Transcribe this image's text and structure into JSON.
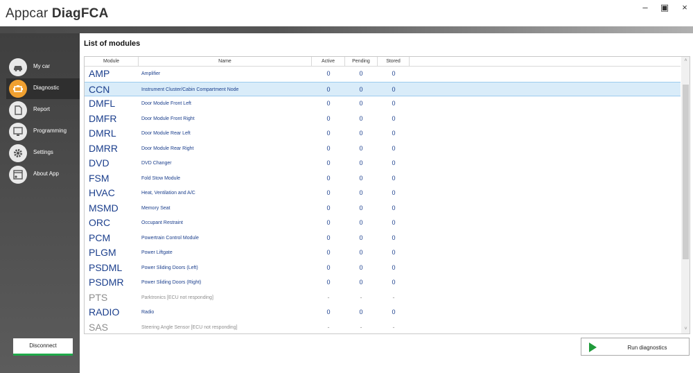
{
  "window": {
    "title_regular": "Appcar ",
    "title_bold": "DiagFCA",
    "minimize_glyph": "–",
    "maximize_glyph": "▣",
    "close_glyph": "×"
  },
  "sidebar": {
    "items": [
      {
        "label": "My car",
        "icon": "car-icon",
        "active": false
      },
      {
        "label": "Diagnostic",
        "icon": "diagnostic-engine-icon",
        "active": true
      },
      {
        "label": "Report",
        "icon": "report-document-icon",
        "active": false
      },
      {
        "label": "Programming",
        "icon": "programming-monitor-icon",
        "active": false
      },
      {
        "label": "Settings",
        "icon": "gear-icon",
        "active": false
      },
      {
        "label": "About App",
        "icon": "about-window-icon",
        "active": false
      }
    ],
    "disconnect_label": "Disconnect"
  },
  "main": {
    "title": "List of modules",
    "columns": {
      "module": "Module",
      "name": "Name",
      "active": "Active",
      "pending": "Pending",
      "stored": "Stored"
    },
    "rows": [
      {
        "module": "AMP",
        "name": "Amplifier",
        "active": "0",
        "pending": "0",
        "stored": "0",
        "state": "ok"
      },
      {
        "module": "CCN",
        "name": "Instrument Cluster/Cabin Compartment Node",
        "active": "0",
        "pending": "0",
        "stored": "0",
        "state": "selected"
      },
      {
        "module": "DMFL",
        "name": "Door Module Front Left",
        "active": "0",
        "pending": "0",
        "stored": "0",
        "state": "ok"
      },
      {
        "module": "DMFR",
        "name": "Door Module Front Right",
        "active": "0",
        "pending": "0",
        "stored": "0",
        "state": "ok"
      },
      {
        "module": "DMRL",
        "name": "Door Module Rear Left",
        "active": "0",
        "pending": "0",
        "stored": "0",
        "state": "ok"
      },
      {
        "module": "DMRR",
        "name": "Door Module Rear Right",
        "active": "0",
        "pending": "0",
        "stored": "0",
        "state": "ok"
      },
      {
        "module": "DVD",
        "name": "DVD Changer",
        "active": "0",
        "pending": "0",
        "stored": "0",
        "state": "ok"
      },
      {
        "module": "FSM",
        "name": "Fold Stow Module",
        "active": "0",
        "pending": "0",
        "stored": "0",
        "state": "ok"
      },
      {
        "module": "HVAC",
        "name": "Heat, Ventilation and A/C",
        "active": "0",
        "pending": "0",
        "stored": "0",
        "state": "ok"
      },
      {
        "module": "MSMD",
        "name": "Memory Seat",
        "active": "0",
        "pending": "0",
        "stored": "0",
        "state": "ok"
      },
      {
        "module": "ORC",
        "name": "Occupant Restraint",
        "active": "0",
        "pending": "0",
        "stored": "0",
        "state": "ok"
      },
      {
        "module": "PCM",
        "name": "Powertrain Control Module",
        "active": "0",
        "pending": "0",
        "stored": "0",
        "state": "ok"
      },
      {
        "module": "PLGM",
        "name": "Power Liftgate",
        "active": "0",
        "pending": "0",
        "stored": "0",
        "state": "ok"
      },
      {
        "module": "PSDML",
        "name": "Power Sliding Doors (Left)",
        "active": "0",
        "pending": "0",
        "stored": "0",
        "state": "ok"
      },
      {
        "module": "PSDMR",
        "name": "Power Sliding Doors (Right)",
        "active": "0",
        "pending": "0",
        "stored": "0",
        "state": "ok"
      },
      {
        "module": "PTS",
        "name": "Parktronics [ECU not responding]",
        "active": "-",
        "pending": "-",
        "stored": "-",
        "state": "disabled"
      },
      {
        "module": "RADIO",
        "name": "Radio",
        "active": "0",
        "pending": "0",
        "stored": "0",
        "state": "ok"
      },
      {
        "module": "SAS",
        "name": "Steering Angle Sensor [ECU not responding]",
        "active": "-",
        "pending": "-",
        "stored": "-",
        "state": "disabled"
      }
    ],
    "scroll_up_glyph": "˄",
    "scroll_down_glyph": "˅",
    "run_label": "Run diagnostics"
  },
  "colors": {
    "accent_active": "#f0a030",
    "module_text": "#1a3e8c",
    "selected_row": "#d9ecf9",
    "disconnect_underline": "#1fa94a",
    "run_icon": "#1f9a3a"
  }
}
